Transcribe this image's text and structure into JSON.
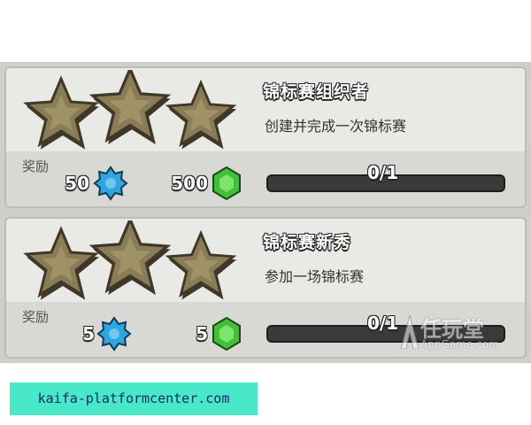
{
  "achievements": [
    {
      "title": "锦标赛组织者",
      "description": "创建并完成一次锦标赛",
      "reward_label": "奖励",
      "reward_xp": "50",
      "reward_gems": "500",
      "progress_text": "0/1",
      "progress_fraction": 0
    },
    {
      "title": "锦标赛新秀",
      "description": "参加一场锦标赛",
      "reward_label": "奖励",
      "reward_xp": "5",
      "reward_gems": "5",
      "progress_text": "0/1",
      "progress_fraction": 0
    }
  ],
  "watermark": {
    "cn": "任玩堂",
    "en": "AppGame.com"
  },
  "footer": {
    "text": "kaifa-platformcenter.com"
  },
  "colors": {
    "star": "#8a7c57",
    "xp": "#2fa6e0",
    "gem": "#3fbf3a",
    "footer_bg": "#49e8c8"
  },
  "icons": [
    "star-icon",
    "xp-icon",
    "gem-icon",
    "appgame-logo-icon"
  ]
}
